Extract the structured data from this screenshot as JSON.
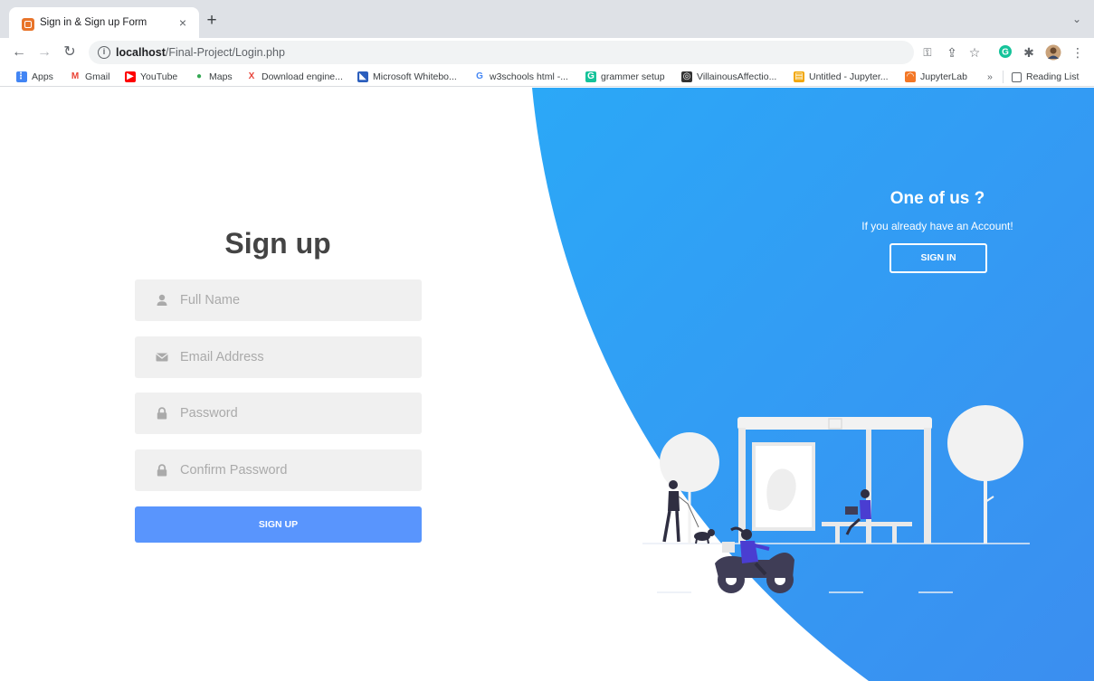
{
  "browser": {
    "tab_title": "Sign in & Sign up Form",
    "tab_close": "×",
    "new_tab": "+",
    "tab_menu": "⌄",
    "url_host": "localhost",
    "url_path": "/Final-Project/Login.php",
    "bookmarks": [
      {
        "label": "Apps",
        "icon": "apps-grid-icon",
        "color": "#4285f4"
      },
      {
        "label": "Gmail",
        "icon": "gmail-icon",
        "color": "#ea4335"
      },
      {
        "label": "YouTube",
        "icon": "youtube-icon",
        "color": "#ff0000"
      },
      {
        "label": "Maps",
        "icon": "maps-pin-icon",
        "color": "#34a853"
      },
      {
        "label": "Download engine...",
        "icon": "x-icon",
        "color": "#e8453c"
      },
      {
        "label": "Microsoft Whitebo...",
        "icon": "whiteboard-icon",
        "color": "#2b5ebd"
      },
      {
        "label": "w3schools html -...",
        "icon": "google-icon",
        "color": "#4285f4"
      },
      {
        "label": "grammer setup",
        "icon": "grammarly-icon",
        "color": "#15c39a"
      },
      {
        "label": "VillainousAffectio...",
        "icon": "replit-icon",
        "color": "#333333"
      },
      {
        "label": "Untitled - Jupyter...",
        "icon": "notebook-icon",
        "color": "#f2a600"
      },
      {
        "label": "JupyterLab",
        "icon": "jupyter-icon",
        "color": "#f37726"
      }
    ],
    "bookmarks_overflow": "»",
    "reading_list": "Reading List"
  },
  "form": {
    "title": "Sign up",
    "fields": [
      {
        "placeholder": "Full Name",
        "icon": "user-icon",
        "type": "text"
      },
      {
        "placeholder": "Email Address",
        "icon": "envelope-icon",
        "type": "email"
      },
      {
        "placeholder": "Password",
        "icon": "lock-icon",
        "type": "password"
      },
      {
        "placeholder": "Confirm Password",
        "icon": "lock-icon",
        "type": "password"
      }
    ],
    "submit_label": "SIGN UP"
  },
  "panel": {
    "title": "One of us ?",
    "subtitle": "If you already have an Account!",
    "button_label": "SIGN IN"
  },
  "colors": {
    "accent": "#5995fd",
    "panel_blue": "#2f9cf4",
    "field_bg": "#f0f0f0",
    "title_text": "#444444"
  }
}
